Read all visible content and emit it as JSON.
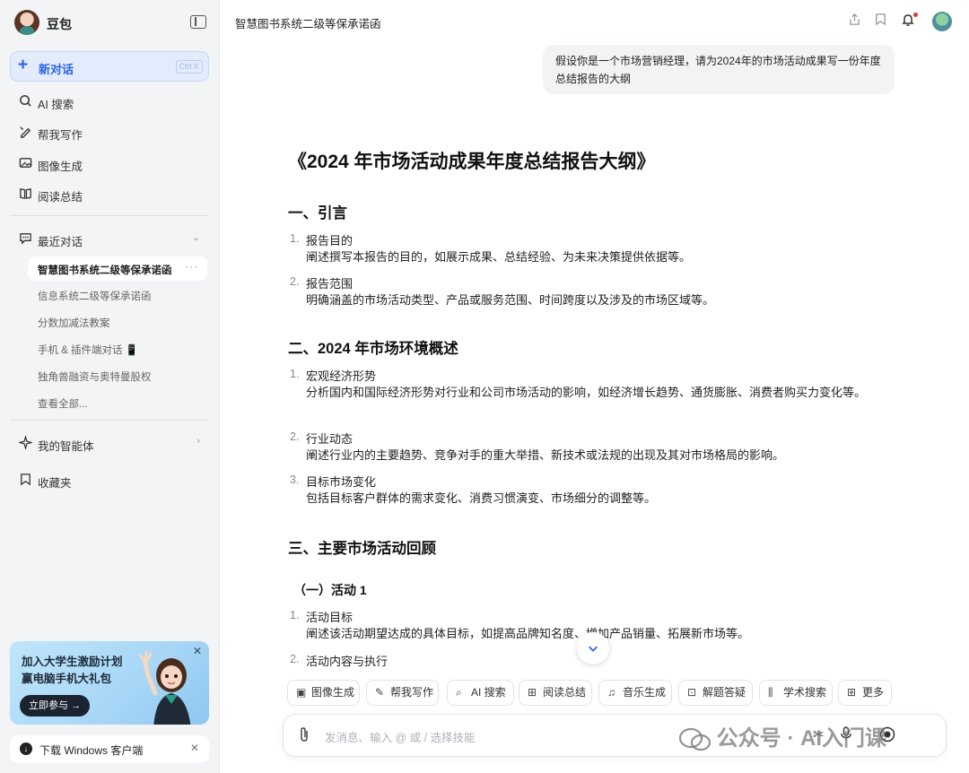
{
  "sidebar": {
    "app_name": "豆包",
    "new_chat": {
      "label": "新对话",
      "shortcut": "Ctrl K"
    },
    "nav": [
      {
        "icon": "ai-search-icon",
        "label": "AI 搜索"
      },
      {
        "icon": "pen-icon",
        "label": "帮我写作"
      },
      {
        "icon": "image-icon",
        "label": "图像生成"
      },
      {
        "icon": "book-icon",
        "label": "阅读总结"
      }
    ],
    "recent_header": "最近对话",
    "recent": [
      {
        "label": "智慧图书系统二级等保承诺函",
        "active": true
      },
      {
        "label": "信息系统二级等保承诺函"
      },
      {
        "label": "分数加减法教案"
      },
      {
        "label": "手机 & 插件端对话 📱"
      },
      {
        "label": "独角兽融资与奥特曼股权"
      },
      {
        "label": "查看全部..."
      }
    ],
    "agents": "我的智能体",
    "favorites": "收藏夹",
    "promo": {
      "line1": "加入大学生激励计划",
      "line2": "赢电脑手机大礼包",
      "button": "立即参与 →"
    },
    "download": "下载 Windows 客户端"
  },
  "topbar": {
    "title": "智慧图书系统二级等保承诺函"
  },
  "user_message": "假设你是一个市场营销经理，请为2024年的市场活动成果写一份年度总结报告的大纲",
  "answer": {
    "title": "《2024 年市场活动成果年度总结报告大纲》",
    "sections": [
      {
        "heading": "一、引言",
        "items": [
          {
            "num": "1.",
            "title": "报告目的",
            "desc": "阐述撰写本报告的目的，如展示成果、总结经验、为未来决策提供依据等。"
          },
          {
            "num": "2.",
            "title": "报告范围",
            "desc": "明确涵盖的市场活动类型、产品或服务范围、时间跨度以及涉及的市场区域等。"
          }
        ]
      },
      {
        "heading": "二、2024 年市场环境概述",
        "items": [
          {
            "num": "1.",
            "title": "宏观经济形势",
            "desc": "分析国内和国际经济形势对行业和公司市场活动的影响，如经济增长趋势、通货膨胀、消费者购买力变化等。"
          },
          {
            "num": "2.",
            "title": "行业动态",
            "desc": "阐述行业内的主要趋势、竞争对手的重大举措、新技术或法规的出现及其对市场格局的影响。"
          },
          {
            "num": "3.",
            "title": "目标市场变化",
            "desc": "包括目标客户群体的需求变化、消费习惯演变、市场细分的调整等。"
          }
        ]
      },
      {
        "heading": "三、主要市场活动回顾",
        "subheading": "（一）活动 1",
        "items": [
          {
            "num": "1.",
            "title": "活动目标",
            "desc": "阐述该活动期望达成的具体目标，如提高品牌知名度、增加产品销量、拓展新市场等。"
          },
          {
            "num": "2.",
            "title": "活动内容与执行"
          }
        ]
      }
    ]
  },
  "skills": [
    "图像生成",
    "帮我写作",
    "AI 搜索",
    "阅读总结",
    "音乐生成",
    "解题答疑",
    "学术搜索",
    "更多"
  ],
  "input": {
    "placeholder": "发消息、输入 @ 或 / 选择技能"
  },
  "watermark": "公众号 · AI入门课"
}
